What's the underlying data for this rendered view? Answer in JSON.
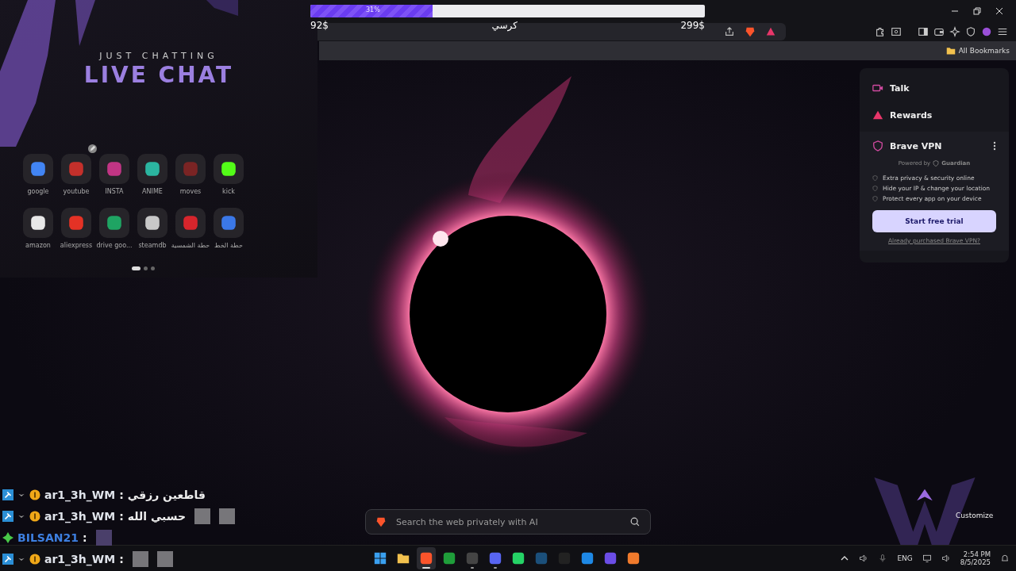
{
  "donation_goal": {
    "level": 0.31,
    "percent": "31%",
    "current": "92$",
    "title": "كرسي",
    "goal": "299$"
  },
  "overlay": {
    "subtitle": "JUST CHATTING",
    "title": "LIVE CHAT"
  },
  "shortcuts": [
    {
      "label": "google",
      "color": "#4285f4",
      "edit": false
    },
    {
      "label": "youtube",
      "color": "#c4302b",
      "edit": true
    },
    {
      "label": "INSTA",
      "color": "#c13584",
      "edit": false
    },
    {
      "label": "ANIME",
      "color": "#2bb5a0",
      "edit": false
    },
    {
      "label": "moves",
      "color": "#7a2424",
      "edit": false
    },
    {
      "label": "kick",
      "color": "#53fc18",
      "edit": false
    },
    {
      "label": "amazon",
      "color": "#e8e8e8",
      "edit": false
    },
    {
      "label": "aliexpress",
      "color": "#e43225",
      "edit": false
    },
    {
      "label": "drive goo...",
      "color": "#1fa463",
      "edit": false
    },
    {
      "label": "steamdb",
      "color": "#c8c8c8",
      "edit": false
    },
    {
      "label": "حطة الشمسية",
      "color": "#d6252c",
      "edit": false
    },
    {
      "label": "حطة الخط",
      "color": "#3b78e7",
      "edit": false
    }
  ],
  "shortcut_pages": [
    {
      "selected": true
    },
    {
      "selected": false
    },
    {
      "selected": false
    }
  ],
  "bookmarks_bar": {
    "label": "All Bookmarks"
  },
  "side_panel": {
    "items": [
      {
        "kind": "talk",
        "label": "Talk"
      },
      {
        "kind": "rewards",
        "label": "Rewards"
      }
    ],
    "vpn": {
      "title": "Brave VPN",
      "powered_by": "Powered by",
      "provider": "Guardian",
      "features": [
        "Extra privacy & security online",
        "Hide your IP & change your location",
        "Protect every app on your device"
      ],
      "button": "Start free trial",
      "link": "Already purchased Brave VPN?"
    }
  },
  "search": {
    "placeholder": "Search the web privately with AI"
  },
  "customize": "Customize",
  "chat": [
    {
      "badges": [
        {
          "kind": "mod"
        },
        {
          "kind": "sub"
        },
        {
          "kind": "bits"
        }
      ],
      "user": "ar1_3h_WM",
      "color": "#dfe3ea",
      "separator": ":",
      "message": "قاطعين رزقي"
    },
    {
      "badges": [
        {
          "kind": "mod"
        },
        {
          "kind": "sub"
        },
        {
          "kind": "bits"
        }
      ],
      "user": "ar1_3h_WM",
      "color": "#dfe3ea",
      "separator": ":",
      "message": "حسبي الله",
      "emotes": [
        {
          "kind": "cat"
        },
        {
          "kind": "cat"
        }
      ]
    },
    {
      "badges": [
        {
          "kind": "gem"
        }
      ],
      "user": "BILSAN21",
      "color": "#3d7fe0",
      "separator": ":",
      "emotes": [
        {
          "kind": "person"
        }
      ]
    },
    {
      "badges": [
        {
          "kind": "mod"
        },
        {
          "kind": "sub"
        },
        {
          "kind": "bits"
        }
      ],
      "user": "ar1_3h_WM",
      "color": "#dfe3ea",
      "separator": ":",
      "emotes": [
        {
          "kind": "cat"
        },
        {
          "kind": "cat"
        }
      ]
    }
  ],
  "taskbar": {
    "apps": [
      {
        "kind": "start",
        "running": false,
        "selected": false
      },
      {
        "kind": "folder",
        "running": false,
        "selected": false
      },
      {
        "kind": "brave",
        "running": true,
        "selected": true
      },
      {
        "kind": "xbox",
        "running": false,
        "selected": false
      },
      {
        "kind": "obs",
        "running": true,
        "selected": false
      },
      {
        "kind": "discord",
        "running": true,
        "selected": false
      },
      {
        "kind": "whatsapp",
        "running": false,
        "selected": false
      },
      {
        "kind": "steam",
        "running": false,
        "selected": false
      },
      {
        "kind": "zoom",
        "running": false,
        "selected": false
      },
      {
        "kind": "sync",
        "running": false,
        "selected": false
      },
      {
        "kind": "play",
        "running": false,
        "selected": false
      },
      {
        "kind": "fa",
        "running": false,
        "selected": false
      }
    ],
    "language": "ENG",
    "time": "2:54 PM",
    "date": "8/5/2025"
  }
}
